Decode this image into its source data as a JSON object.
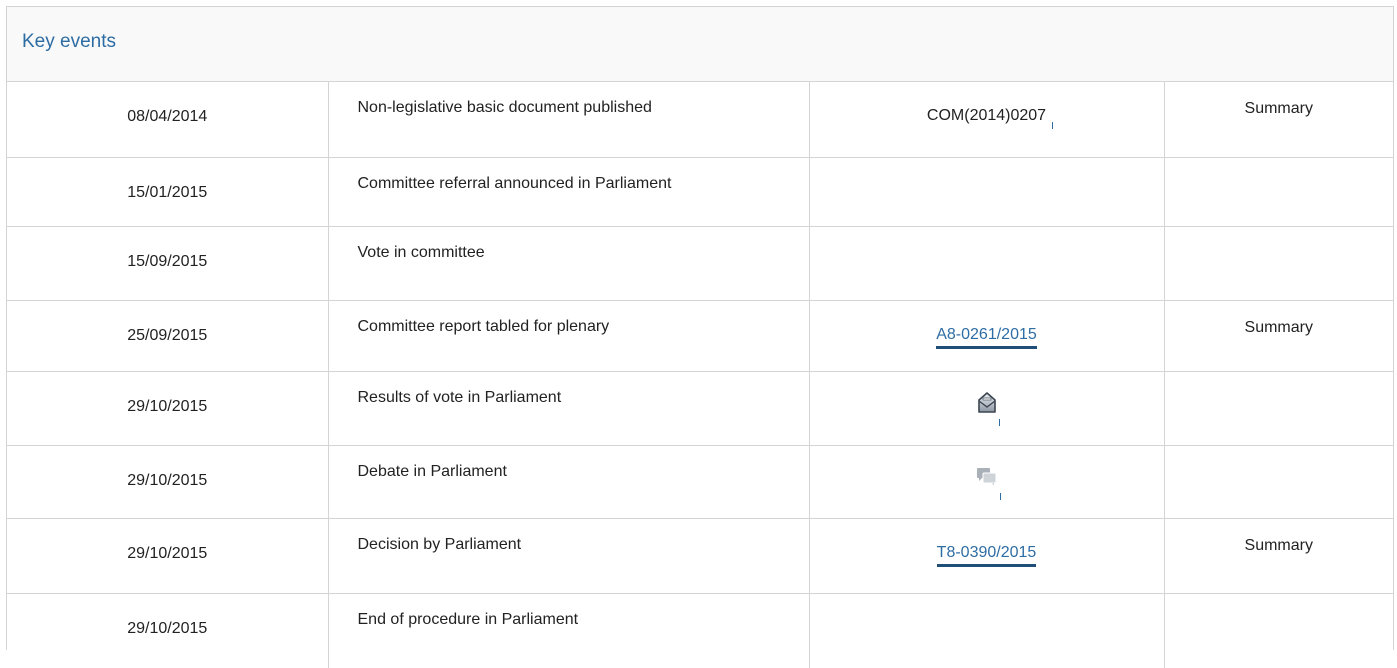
{
  "panel": {
    "title": "Key events"
  },
  "events": [
    {
      "date": "08/04/2014",
      "event": "Non-legislative basic document published",
      "doc": "COM(2014)0207",
      "summary": "Summary"
    },
    {
      "date": "15/01/2015",
      "event": "Committee referral announced in Parliament",
      "doc": "",
      "summary": ""
    },
    {
      "date": "15/09/2015",
      "event": "Vote in committee",
      "doc": "",
      "summary": ""
    },
    {
      "date": "25/09/2015",
      "event": "Committee report tabled for plenary",
      "doc": "A8-0261/2015",
      "summary": "Summary"
    },
    {
      "date": "29/10/2015",
      "event": "Results of vote in Parliament",
      "doc_icon": "ballot-box-icon",
      "summary": ""
    },
    {
      "date": "29/10/2015",
      "event": "Debate in Parliament",
      "doc_icon": "debate-speech-bubbles-icon",
      "summary": ""
    },
    {
      "date": "29/10/2015",
      "event": "Decision by Parliament",
      "doc": "T8-0390/2015",
      "summary": "Summary"
    },
    {
      "date": "29/10/2015",
      "event": "End of procedure in Parliament",
      "doc": "",
      "summary": ""
    }
  ],
  "colors": {
    "title": "#2e6da4",
    "link": "#2e6da4",
    "link_underline": "#1f4e79",
    "border": "#d4d4d4",
    "header_bg": "#f9f9f9",
    "text": "#222222"
  }
}
